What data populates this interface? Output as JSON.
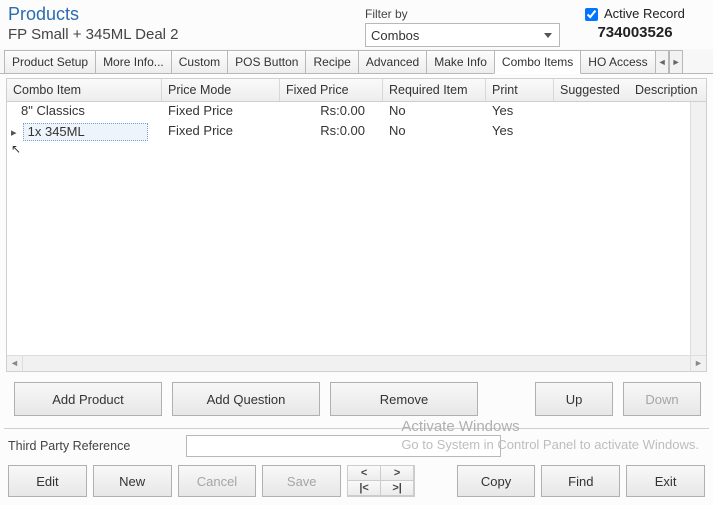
{
  "header": {
    "title": "Products",
    "product_name": "FP Small + 345ML Deal 2",
    "filter_label": "Filter by",
    "filter_value": "Combos",
    "active_record_label": "Active Record",
    "active_record_checked": true,
    "record_number": "734003526"
  },
  "tabs": [
    "Product Setup",
    "More Info...",
    "Custom",
    "POS Button",
    "Recipe",
    "Advanced",
    "Make Info",
    "Combo Items",
    "HO Access"
  ],
  "active_tab": "Combo Items",
  "grid": {
    "columns": [
      "Combo Item",
      "Price Mode",
      "Fixed Price",
      "Required Item",
      "Print",
      "Suggested",
      "Description"
    ],
    "rows": [
      {
        "item": "8\" Classics",
        "mode": "Fixed Price",
        "price": "Rs:0.00",
        "required": "No",
        "print": "Yes",
        "suggested": "",
        "desc": "",
        "selected": false
      },
      {
        "item": "1x 345ML",
        "mode": "Fixed Price",
        "price": "Rs:0.00",
        "required": "No",
        "print": "Yes",
        "suggested": "",
        "desc": "",
        "selected": true
      }
    ]
  },
  "actions": {
    "add_product": "Add Product",
    "add_question": "Add Question",
    "remove": "Remove",
    "up": "Up",
    "down": "Down"
  },
  "footer": {
    "tpr_label": "Third Party Reference",
    "tpr_value": "",
    "edit": "Edit",
    "new": "New",
    "cancel": "Cancel",
    "save": "Save",
    "copy": "Copy",
    "find": "Find",
    "exit": "Exit",
    "nav_prev": "<",
    "nav_next": ">",
    "nav_first": "|<",
    "nav_last": ">|"
  },
  "watermark": {
    "title": "Activate Windows",
    "sub": "Go to System in Control Panel to activate Windows."
  }
}
